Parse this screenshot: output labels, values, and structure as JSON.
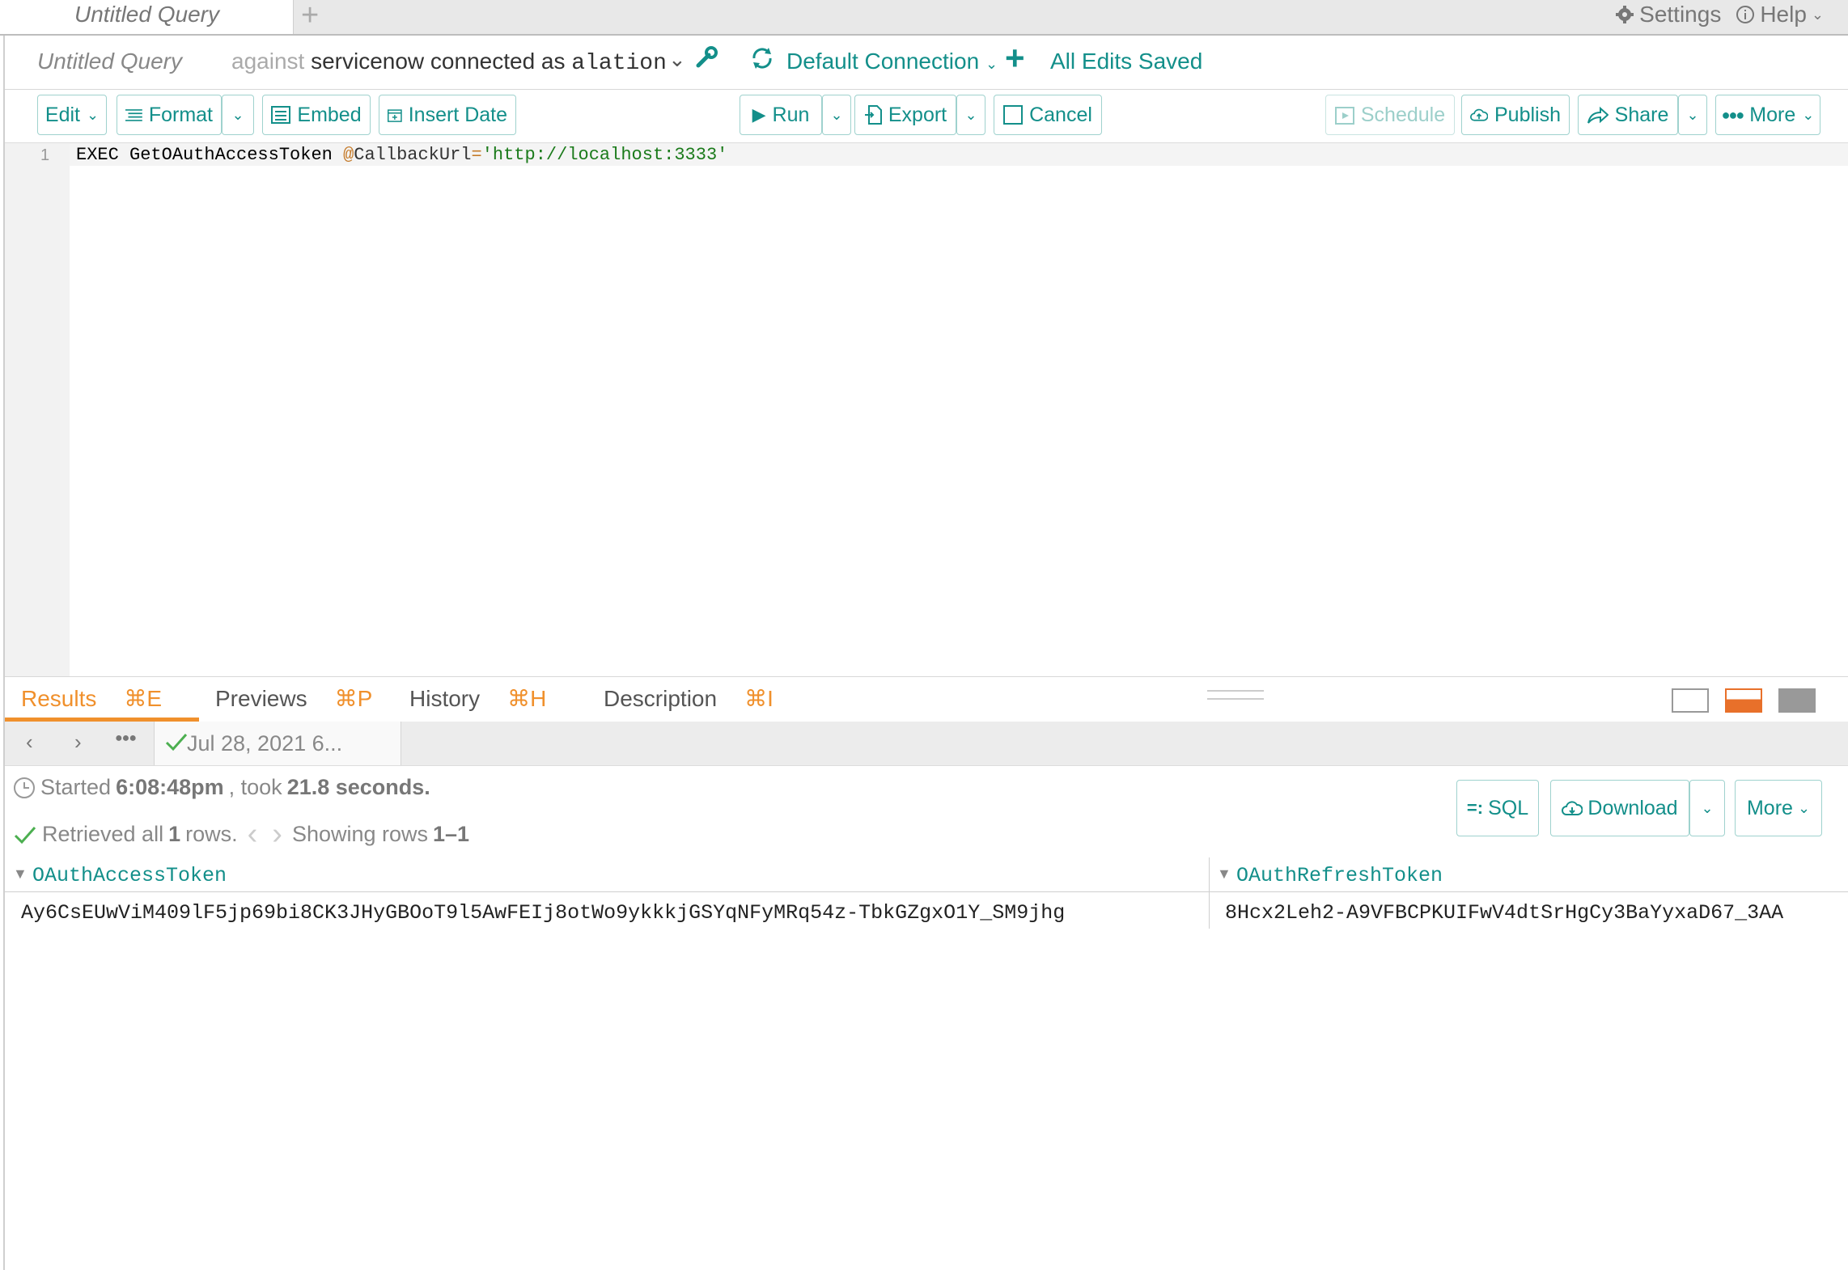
{
  "tabs": {
    "query_tab": "Untitled Query",
    "new_tab": "+"
  },
  "top_right": {
    "settings": "Settings",
    "help": "Help"
  },
  "header": {
    "title": "Untitled Query",
    "against": "against",
    "datasource": "servicenow",
    "connected_as": "connected as",
    "user": "alation",
    "connection": "Default Connection",
    "save_status": "All Edits Saved"
  },
  "toolbar": {
    "edit": "Edit",
    "format": "Format",
    "embed": "Embed",
    "insert_date": "Insert Date",
    "run": "Run",
    "export": "Export",
    "cancel": "Cancel",
    "schedule": "Schedule",
    "publish": "Publish",
    "share": "Share",
    "more": "More"
  },
  "editor": {
    "line_number": "1",
    "kw": "EXEC GetOAuthAccessToken ",
    "at": "@",
    "param": "CallbackUrl",
    "eq": "=",
    "str": "'http://localhost:3333'"
  },
  "result_tabs": [
    {
      "label": "Results",
      "key": "⌘E"
    },
    {
      "label": "Previews",
      "key": "⌘P"
    },
    {
      "label": "History",
      "key": "⌘H"
    },
    {
      "label": "Description",
      "key": "⌘I"
    }
  ],
  "history": {
    "entry": "Jul 28, 2021 6..."
  },
  "status": {
    "started_prefix": "Started ",
    "started_time": "6:08:48pm",
    "took_prefix": ", took ",
    "took_value": "21.8 seconds.",
    "retrieved_prefix": "Retrieved all ",
    "retrieved_count": "1",
    "retrieved_suffix": " rows.",
    "showing_prefix": "Showing rows ",
    "showing_range": "1–1"
  },
  "result_buttons": {
    "sql": "SQL",
    "download": "Download",
    "more": "More"
  },
  "grid": {
    "columns": [
      "OAuthAccessToken",
      "OAuthRefreshToken"
    ],
    "rows": [
      [
        "Ay6CsEUwViM409lF5jp69bi8CK3JHyGBOoT9l5AwFEIj8otWo9ykkkjGSYqNFyMRq54z-TbkGZgxO1Y_SM9jhg",
        "8Hcx2Leh2-A9VFBCPKUIFwV4dtSrHgCy3BaYyxaD67_3AA"
      ]
    ]
  },
  "colors": {
    "accent": "#138f8a",
    "orange": "#f0902c"
  }
}
